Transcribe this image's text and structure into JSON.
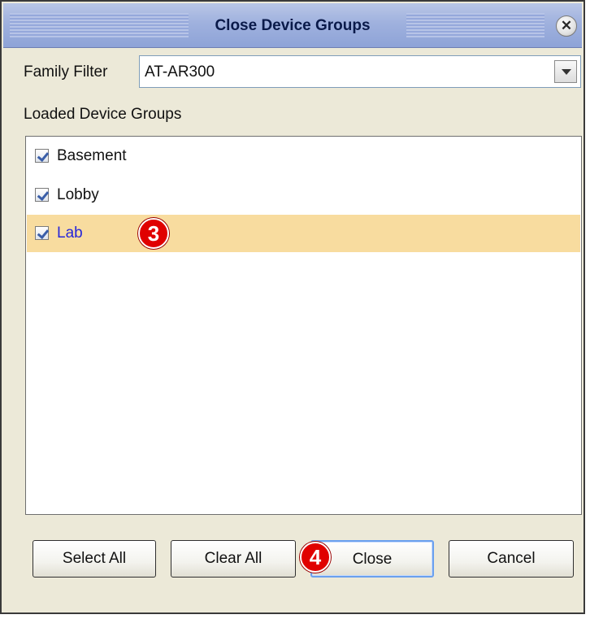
{
  "dialog": {
    "title": "Close Device Groups"
  },
  "family_filter": {
    "label": "Family Filter",
    "value": "AT-AR300"
  },
  "groups": {
    "label": "Loaded Device Groups",
    "items": [
      {
        "label": "Basement",
        "checked": true,
        "selected": false
      },
      {
        "label": "Lobby",
        "checked": true,
        "selected": false
      },
      {
        "label": "Lab",
        "checked": true,
        "selected": true
      }
    ]
  },
  "callouts": {
    "three": "3",
    "four": "4"
  },
  "buttons": {
    "select_all": "Select All",
    "clear_all": "Clear All",
    "close": "Close",
    "cancel": "Cancel"
  },
  "colors": {
    "selection": "#f8dc9f",
    "callout": "#e00000",
    "selected_text": "#2727d9"
  }
}
